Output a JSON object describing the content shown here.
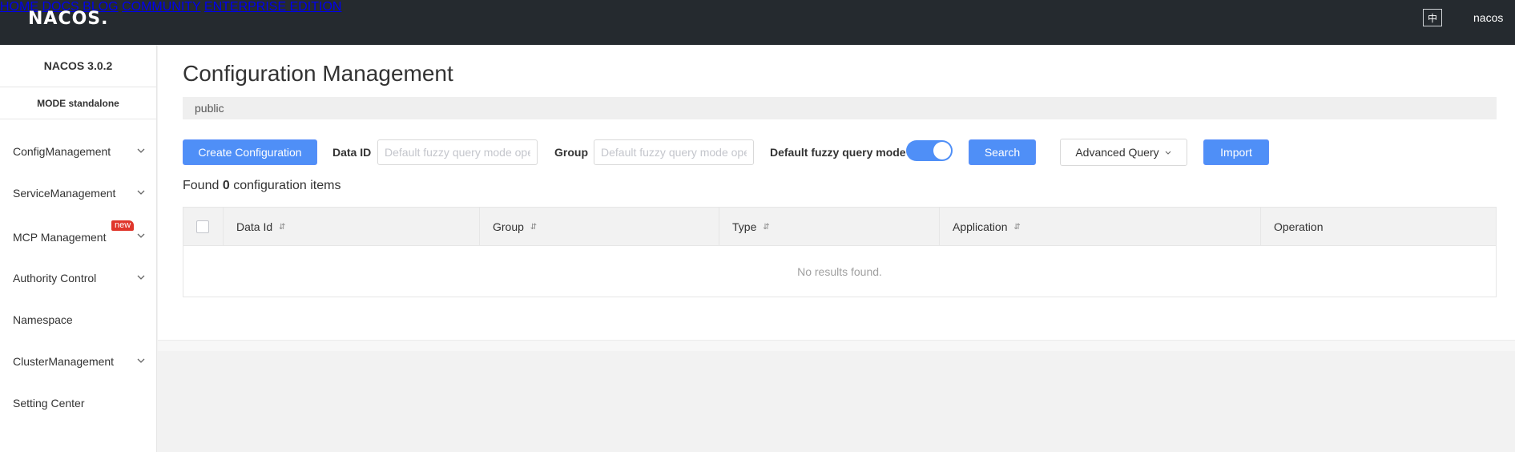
{
  "header": {
    "logo": "NACOS.",
    "nav": [
      "HOME",
      "DOCS",
      "BLOG",
      "COMMUNITY",
      "ENTERPRISE EDITION"
    ],
    "lang": "中",
    "user": "nacos"
  },
  "sidebar": {
    "version": "NACOS 3.0.2",
    "mode_label": "MODE",
    "mode_value": "standalone",
    "items": [
      {
        "label": "ConfigManagement",
        "expandable": true
      },
      {
        "label": "ServiceManagement",
        "expandable": true
      },
      {
        "label": "MCP Management",
        "expandable": true,
        "badge": "new"
      },
      {
        "label": "Authority Control",
        "expandable": true
      },
      {
        "label": "Namespace",
        "expandable": false
      },
      {
        "label": "ClusterManagement",
        "expandable": true
      },
      {
        "label": "Setting Center",
        "expandable": false
      }
    ]
  },
  "main": {
    "title": "Configuration Management",
    "namespace": "public",
    "toolbar": {
      "create_label": "Create Configuration",
      "data_id_label": "Data ID",
      "data_id_placeholder": "Default fuzzy query mode ope",
      "group_label": "Group",
      "group_placeholder": "Default fuzzy query mode ope",
      "fuzzy_label": "Default fuzzy query mode",
      "fuzzy_on": true,
      "search_label": "Search",
      "advanced_label": "Advanced Query",
      "import_label": "Import"
    },
    "found_prefix": "Found",
    "found_count": "0",
    "found_suffix": "configuration items",
    "table": {
      "columns": [
        "Data Id",
        "Group",
        "Type",
        "Application",
        "Operation"
      ],
      "sort_glyph": "⇵",
      "empty_text": "No results found."
    }
  },
  "colors": {
    "topbar": "#252a2f",
    "primary": "#4f8ff7",
    "badge": "#e0362b"
  }
}
